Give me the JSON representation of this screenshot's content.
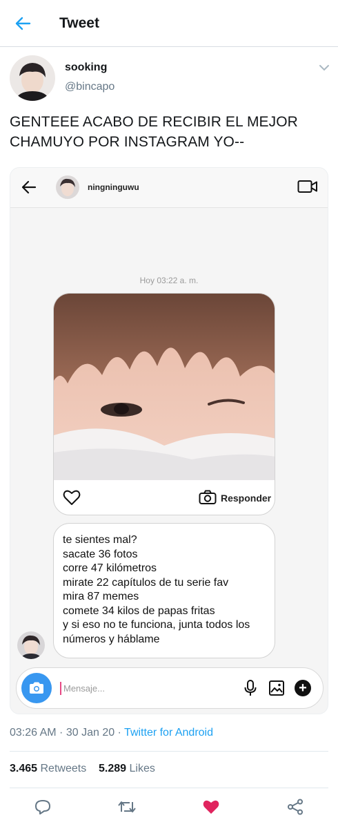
{
  "header": {
    "title": "Tweet"
  },
  "author": {
    "name": "sooking",
    "handle": "@bincapo"
  },
  "tweet": {
    "text_line1": "GENTEEE ACABO DE RECIBIR EL MEJOR",
    "text_line2": "CHAMUYO POR INSTAGRAM YO--"
  },
  "dm": {
    "username": "ningninguwu",
    "timestamp": "Hoy 03:22 a. m.",
    "reply_label": "Responder",
    "message_lines": [
      "te sientes mal?",
      "sacate 36 fotos",
      "corre 47 kilómetros",
      "mirate 22 capítulos de tu serie fav",
      "mira 87 memes",
      "comete 34 kilos de papas fritas",
      "y si eso no te funciona, junta todos los",
      "números y háblame"
    ],
    "composer_placeholder": "Mensaje..."
  },
  "meta": {
    "time": "03:26 AM",
    "date": "30 Jan 20",
    "source": "Twitter for Android",
    "separator": " · "
  },
  "stats": {
    "retweets": "3.465",
    "retweets_label": "Retweets",
    "likes": "5.289",
    "likes_label": "Likes"
  },
  "colors": {
    "accent": "#1da1f2",
    "like": "#e0245e",
    "ig_blue": "#3897f0",
    "muted": "#657786"
  },
  "icons": [
    "back-arrow-icon",
    "chevron-down-icon",
    "video-call-icon",
    "heart-outline-icon",
    "camera-icon",
    "mic-icon",
    "gallery-icon",
    "plus-icon",
    "reply-icon",
    "retweet-icon",
    "like-icon",
    "share-icon"
  ]
}
